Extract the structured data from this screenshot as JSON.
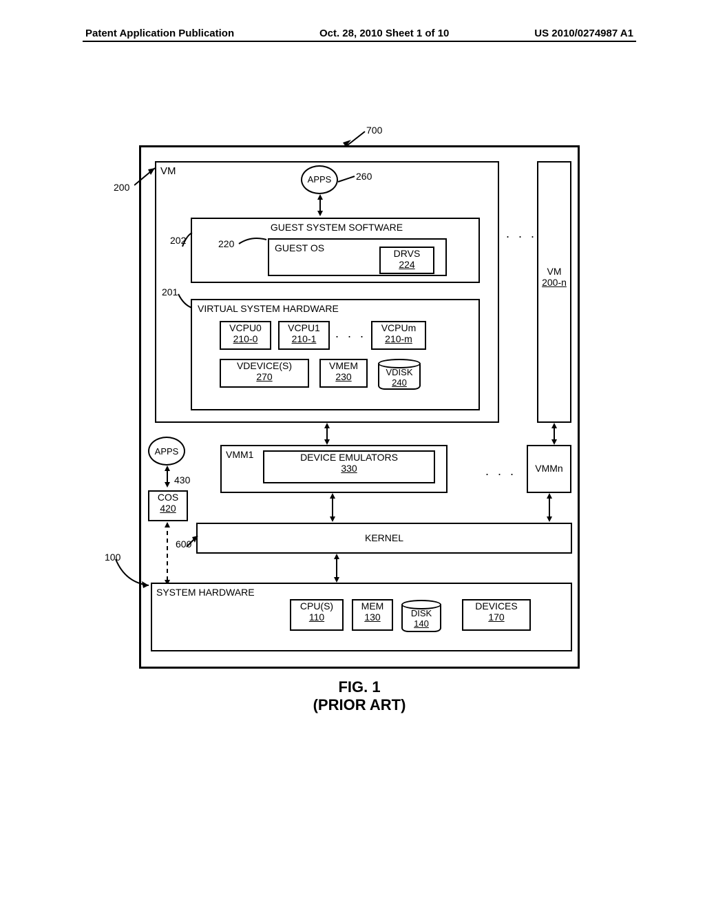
{
  "header": {
    "left": "Patent Application Publication",
    "mid": "Oct. 28, 2010  Sheet 1 of 10",
    "right": "US 2010/0274987 A1"
  },
  "refs": {
    "r700": "700",
    "r200": "200",
    "r260": "260",
    "r202": "202",
    "r220": "220",
    "r201": "201",
    "r430": "430",
    "r100": "100",
    "r600": "600"
  },
  "labels": {
    "vm": "VM",
    "apps": "APPS",
    "gss": "GUEST SYSTEM SOFTWARE",
    "gos": "GUEST OS",
    "drvs_a": "DRVS",
    "drvs_b": "224",
    "vmn_a": "VM",
    "vmn_b": "200-n",
    "vsh": "VIRTUAL SYSTEM HARDWARE",
    "vcpu0_a": "VCPU0",
    "vcpu0_b": "210-0",
    "vcpu1_a": "VCPU1",
    "vcpu1_b": "210-1",
    "vcpum_a": "VCPUm",
    "vcpum_b": "210-m",
    "vdev_a": "VDEVICE(S)",
    "vdev_b": "270",
    "vmem_a": "VMEM",
    "vmem_b": "230",
    "vdisk_a": "VDISK",
    "vdisk_b": "240",
    "vmm1": "VMM1",
    "de_a": "DEVICE EMULATORS",
    "de_b": "330",
    "vmmn": "VMMn",
    "cos_a": "COS",
    "cos_b": "420",
    "kernel": "KERNEL",
    "sh": "SYSTEM HARDWARE",
    "cpu_a": "CPU(S)",
    "cpu_b": "110",
    "mem_a": "MEM",
    "mem_b": "130",
    "disk_a": "DISK",
    "disk_b": "140",
    "dev_a": "DEVICES",
    "dev_b": "170"
  },
  "caption": {
    "line1": "FIG. 1",
    "line2": "(PRIOR ART)"
  }
}
